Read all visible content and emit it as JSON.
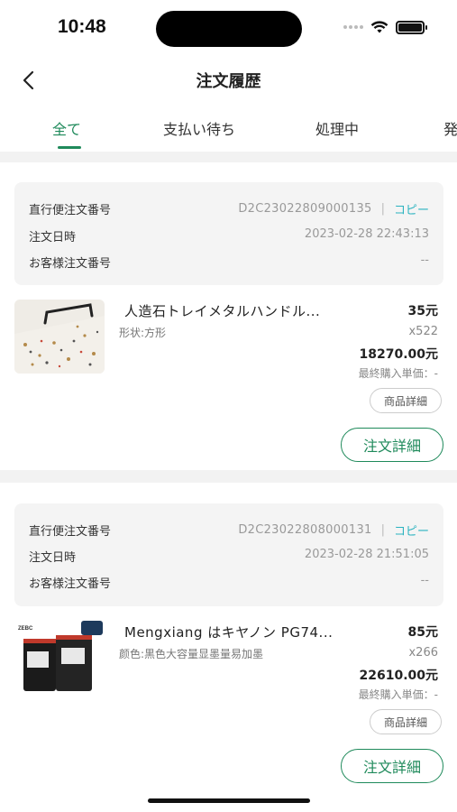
{
  "status": {
    "time": "10:48"
  },
  "nav": {
    "title": "注文履歴"
  },
  "tabs": [
    {
      "label": "全て",
      "active": true
    },
    {
      "label": "支払い待ち",
      "active": false
    },
    {
      "label": "処理中",
      "active": false
    },
    {
      "label": "発",
      "active": false
    }
  ],
  "labels": {
    "express_order_no": "直行便注文番号",
    "order_date": "注文日時",
    "customer_order_no": "お客様注文番号",
    "copy": "コピー",
    "separator": "|",
    "last_price_label": "最終購入単価：-",
    "product_detail": "商品詳細",
    "order_detail": "注文詳細"
  },
  "orders": [
    {
      "order_no": "D2C23022809000135",
      "order_date": "2023-02-28 22:43:13",
      "customer_order_no": "--",
      "product": {
        "name": "人造石トレイメタルハンドル...",
        "attr": "形状:方形",
        "price": "35元",
        "qty": "x522",
        "total": "18270.00元"
      }
    },
    {
      "order_no": "D2C23022808000131",
      "order_date": "2023-02-28 21:51:05",
      "customer_order_no": "--",
      "product": {
        "name": "Mengxiang はキヤノン PG74...",
        "attr": "颜色:黒色大容量显墨量易加墨",
        "price": "85元",
        "qty": "x266",
        "total": "22610.00元"
      }
    }
  ],
  "colors": {
    "accent": "#1f8a5b",
    "copy": "#2bb3c0",
    "section_bg": "#f2f2f2"
  },
  "icons": [
    "back-chevron-icon",
    "wifi-icon",
    "battery-icon",
    "signal-icon"
  ]
}
